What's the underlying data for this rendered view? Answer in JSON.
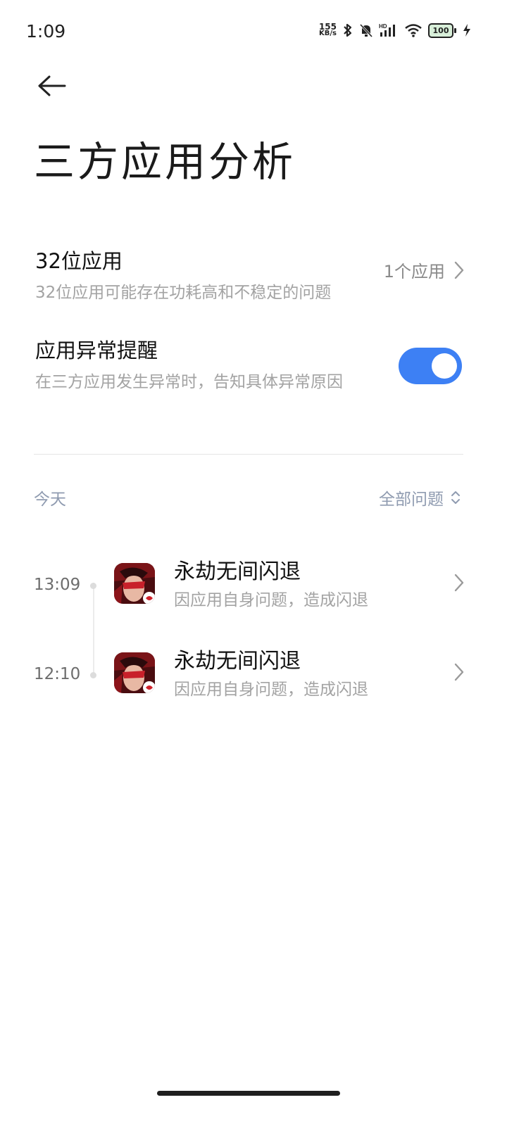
{
  "status_bar": {
    "time": "1:09",
    "net_speed_value": "155",
    "net_speed_unit": "KB/s",
    "battery_level": "100",
    "icons": [
      "bluetooth-icon",
      "mute-bell-icon",
      "hd-signal-icon",
      "wifi-icon",
      "battery-icon",
      "charging-icon"
    ]
  },
  "header": {
    "back_icon": "back-arrow-icon",
    "title": "三方应用分析"
  },
  "settings": {
    "bit32": {
      "title": "32位应用",
      "description": "32位应用可能存在功耗高和不稳定的问题",
      "value": "1个应用"
    },
    "anomaly_alert": {
      "title": "应用异常提醒",
      "description": "在三方应用发生异常时，告知具体异常原因",
      "enabled": true
    }
  },
  "timeline": {
    "day_label": "今天",
    "filter_label": "全部问题",
    "items": [
      {
        "time": "13:09",
        "title": "永劫无间闪退",
        "description": "因应用自身问题，造成闪退"
      },
      {
        "time": "12:10",
        "title": "永劫无间闪退",
        "description": "因应用自身问题，造成闪退"
      }
    ]
  },
  "colors": {
    "accent": "#3d80f4",
    "secondary_text": "#a3a3a3",
    "filter_text": "#8f9bb0"
  }
}
